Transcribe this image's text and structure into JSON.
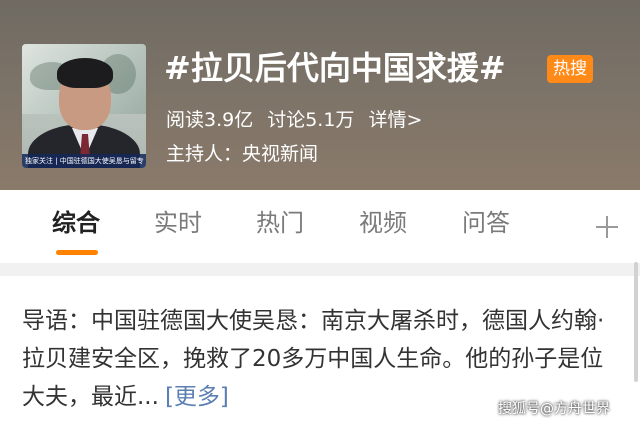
{
  "header": {
    "topic_title": "#拉贝后代向中国求援#",
    "hot_badge": "热搜",
    "reads": "阅读3.9亿",
    "discussions": "讨论5.1万",
    "details_link": "详情>",
    "host": "主持人：央视新闻",
    "thumbnail_caption": "独家关注 | 中国驻德国大使吴恳与留专"
  },
  "tabs": [
    {
      "label": "综合",
      "active": true
    },
    {
      "label": "实时",
      "active": false
    },
    {
      "label": "热门",
      "active": false
    },
    {
      "label": "视频",
      "active": false
    },
    {
      "label": "问答",
      "active": false
    }
  ],
  "plus_icon": "plus-icon",
  "intro": {
    "text": "导语：中国驻德国大使吴恳：南京大屠杀时，德国人约翰·拉贝建安全区，挽救了20多万中国人生命。他的孙子是位大夫，最近...",
    "more_label": "[更多]"
  },
  "watermark": "搜狐号@方舟世界",
  "colors": {
    "accent": "#ff8200",
    "hot_badge": "#ff8a18",
    "link": "#5b7fb3"
  }
}
